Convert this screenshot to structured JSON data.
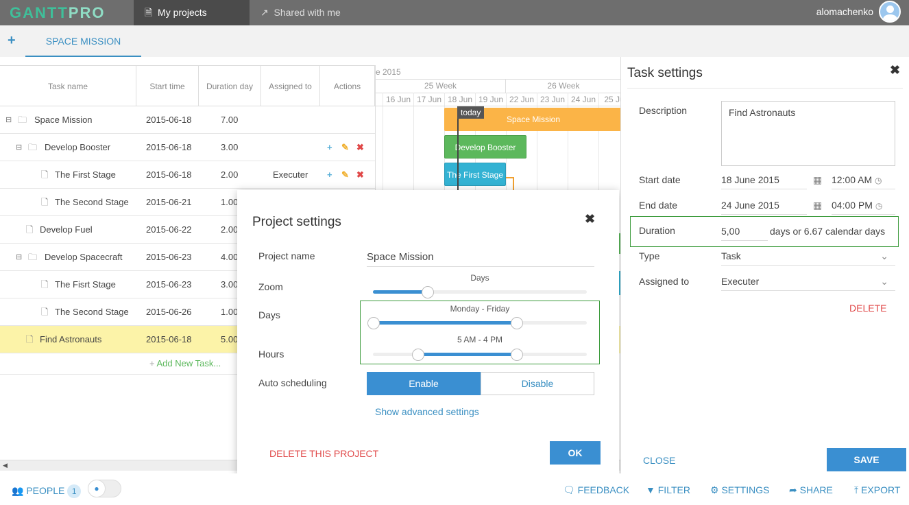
{
  "brand": {
    "logo_a": "GANTT",
    "logo_b": "PRO"
  },
  "nav": {
    "my_projects": "My projects",
    "shared": "Shared with me",
    "user": "alomachenko"
  },
  "project_tab": "SPACE MISSION",
  "grid": {
    "headers": [
      "Task name",
      "Start time",
      "Duration day",
      "Assigned to",
      "Actions"
    ],
    "rows": [
      {
        "name": "Space Mission",
        "start": "2015-06-18",
        "duration": "7.00",
        "assigned": "",
        "type": "folder",
        "level": 0,
        "actions": false
      },
      {
        "name": "Develop Booster",
        "start": "2015-06-18",
        "duration": "3.00",
        "assigned": "",
        "type": "folder",
        "level": 1,
        "actions": true
      },
      {
        "name": "The First Stage",
        "start": "2015-06-18",
        "duration": "2.00",
        "assigned": "Executer",
        "type": "file",
        "level": 2,
        "actions": true
      },
      {
        "name": "The Second Stage",
        "start": "2015-06-21",
        "duration": "1.00",
        "assigned": "",
        "type": "file",
        "level": 2,
        "actions": false
      },
      {
        "name": "Develop Fuel",
        "start": "2015-06-22",
        "duration": "2.00",
        "assigned": "",
        "type": "file",
        "level": 1,
        "actions": false
      },
      {
        "name": "Develop Spacecraft",
        "start": "2015-06-23",
        "duration": "4.00",
        "assigned": "",
        "type": "folder",
        "level": 1,
        "actions": false
      },
      {
        "name": "The Fisrt Stage",
        "start": "2015-06-23",
        "duration": "3.00",
        "assigned": "",
        "type": "file",
        "level": 2,
        "actions": false
      },
      {
        "name": "The Second Stage",
        "start": "2015-06-26",
        "duration": "1.00",
        "assigned": "",
        "type": "file",
        "level": 2,
        "actions": false
      },
      {
        "name": "Find Astronauts",
        "start": "2015-06-18",
        "duration": "5.00",
        "assigned": "",
        "type": "file",
        "level": 1,
        "actions": false,
        "selected": true
      }
    ],
    "add_task": "Add New Task..."
  },
  "gantt": {
    "month": "e 2015",
    "weeks": [
      "25 Week",
      "26 Week"
    ],
    "days": [
      "16 Jun",
      "17 Jun",
      "18 Jun",
      "19 Jun",
      "22 Jun",
      "23 Jun",
      "24 Jun",
      "25 Ju"
    ],
    "today": "today",
    "bars": [
      {
        "label": "Space Mission",
        "color": "#fbb447"
      },
      {
        "label": "Develop Booster",
        "color": "#5cb85c"
      },
      {
        "label": "The First Stage",
        "color": "#33b2d3"
      }
    ]
  },
  "project_settings": {
    "title": "Project settings",
    "name_label": "Project name",
    "name_value": "Space Mission",
    "zoom_label": "Zoom",
    "zoom_value": "Days",
    "days_label": "Days",
    "days_value": "Monday - Friday",
    "hours_label": "Hours",
    "hours_value": "5 AM - 4 PM",
    "auto_label": "Auto scheduling",
    "enable": "Enable",
    "disable": "Disable",
    "advanced": "Show advanced settings",
    "delete": "DELETE THIS PROJECT",
    "ok": "OK"
  },
  "task_settings": {
    "title": "Task settings",
    "description_label": "Description",
    "description": "Find Astronauts",
    "start_label": "Start date",
    "start_date": "18 June 2015",
    "start_time": "12:00 AM",
    "end_label": "End date",
    "end_date": "24 June 2015",
    "end_time": "04:00 PM",
    "duration_label": "Duration",
    "duration": "5,00",
    "duration_suffix": "days or 6.67 calendar days",
    "type_label": "Type",
    "type": "Task",
    "assigned_label": "Assigned to",
    "assigned": "Executer",
    "delete": "DELETE",
    "close": "CLOSE",
    "save": "SAVE"
  },
  "footer": {
    "people": "PEOPLE",
    "people_count": "1",
    "feedback": "FEEDBACK",
    "filter": "FILTER",
    "settings": "SETTINGS",
    "share": "SHARE",
    "export": "EXPORT"
  }
}
